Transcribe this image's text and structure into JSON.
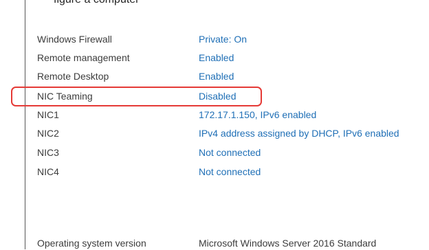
{
  "header_fragment": "figure a computer",
  "properties": [
    {
      "label": "Windows Firewall",
      "value": "Private: On"
    },
    {
      "label": "Remote management",
      "value": "Enabled"
    },
    {
      "label": "Remote Desktop",
      "value": "Enabled"
    },
    {
      "label": "NIC Teaming",
      "value": "Disabled"
    },
    {
      "label": "NIC1",
      "value": "172.17.1.150, IPv6 enabled"
    },
    {
      "label": "NIC2",
      "value": "IPv4 address assigned by DHCP, IPv6 enabled"
    },
    {
      "label": "NIC3",
      "value": "Not connected"
    },
    {
      "label": "NIC4",
      "value": "Not connected"
    }
  ],
  "os": {
    "label": "Operating system version",
    "value": "Microsoft Windows Server 2016 Standard"
  },
  "colors": {
    "link": "#1f6fb6",
    "highlight": "#e53935",
    "label_text": "#3c3c3c"
  }
}
